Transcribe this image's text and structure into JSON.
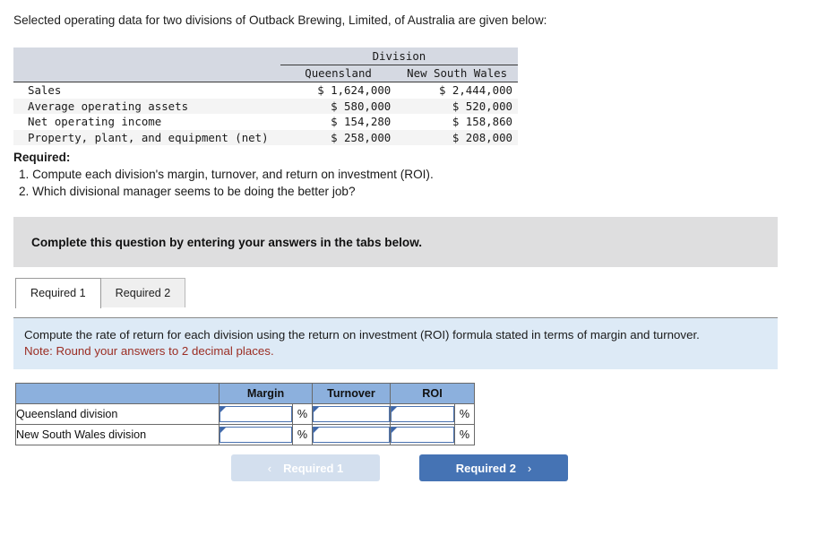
{
  "intro": "Selected operating data for two divisions of Outback Brewing, Limited, of Australia are given below:",
  "data_table": {
    "group_header": "Division",
    "columns": [
      "",
      "Queensland",
      "New South Wales"
    ],
    "rows": [
      {
        "label": "Sales",
        "queensland": "$ 1,624,000",
        "new_south_wales": "$ 2,444,000"
      },
      {
        "label": "Average operating assets",
        "queensland": "$ 580,000",
        "new_south_wales": "$ 520,000"
      },
      {
        "label": "Net operating income",
        "queensland": "$ 154,280",
        "new_south_wales": "$ 158,860"
      },
      {
        "label": "Property, plant, and equipment (net)",
        "queensland": "$ 258,000",
        "new_south_wales": "$ 208,000"
      }
    ]
  },
  "required": {
    "title": "Required:",
    "items": [
      "1. Compute each division's margin, turnover, and return on investment (ROI).",
      "2. Which divisional manager seems to be doing the better job?"
    ]
  },
  "banner": {
    "text": "Complete this question by entering your answers in the tabs below."
  },
  "tabs": [
    {
      "label": "Required 1",
      "active": true
    },
    {
      "label": "Required 2",
      "active": false
    }
  ],
  "instruction": {
    "text": "Compute the rate of return for each division using the return on investment (ROI) formula stated in terms of margin and turnover.",
    "note": "Note: Round your answers to 2 decimal places."
  },
  "answer_table": {
    "headers": [
      "",
      "Margin",
      "Turnover",
      "ROI"
    ],
    "percent_symbol": "%",
    "rows": [
      {
        "label": "Queensland division",
        "margin": "",
        "turnover": "",
        "roi": ""
      },
      {
        "label": "New South Wales division",
        "margin": "",
        "turnover": "",
        "roi": ""
      }
    ]
  },
  "nav": {
    "prev_label": "Required 1",
    "next_label": "Required 2",
    "prev_chevron": "‹",
    "next_chevron": "›"
  },
  "colors": {
    "banner_gray": "#dededf",
    "panel_blue": "#ddeaf6",
    "table_header_blue": "#8cb0dd",
    "primary_button": "#4573b4",
    "disabled_button": "#d3dfee",
    "note_red": "#9b2d23",
    "data_header_band": "#d5d9e2"
  }
}
